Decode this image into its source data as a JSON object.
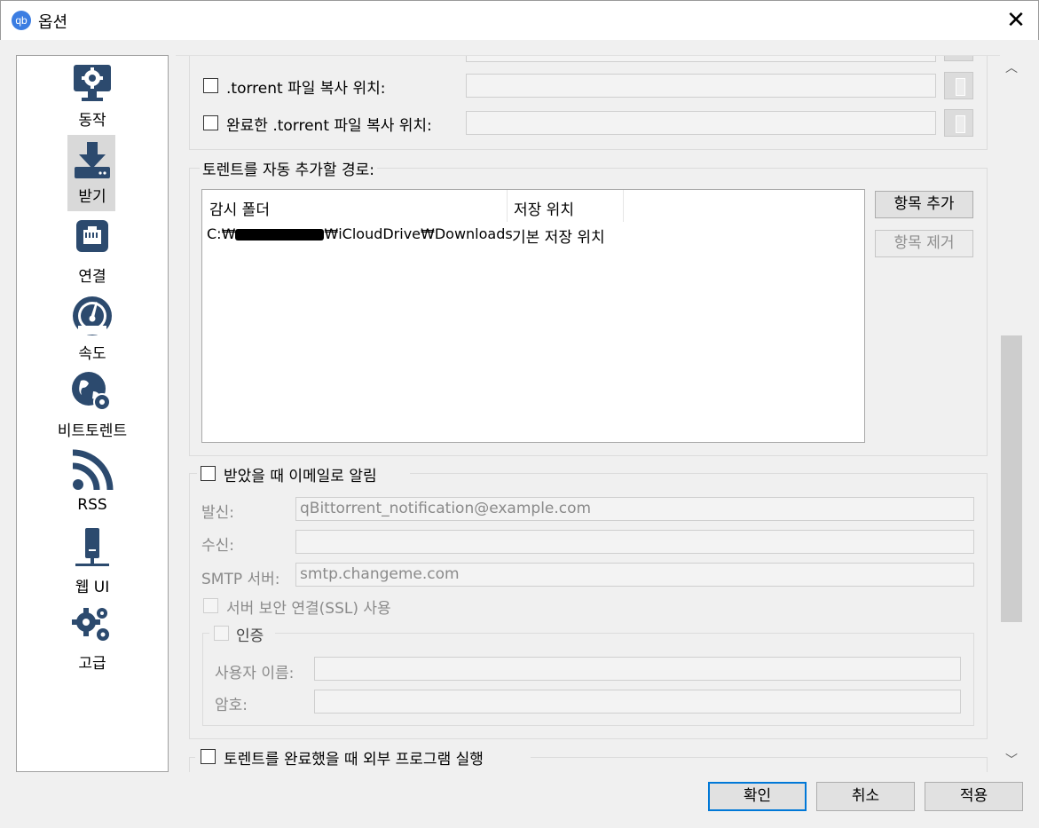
{
  "window": {
    "title": "옵션",
    "app_icon_text": "qb"
  },
  "sidebar": {
    "items": [
      {
        "label": "동작",
        "icon": "monitor-gear-icon"
      },
      {
        "label": "받기",
        "icon": "download-icon"
      },
      {
        "label": "연결",
        "icon": "network-port-icon"
      },
      {
        "label": "속도",
        "icon": "speedometer-icon"
      },
      {
        "label": "비트토렌트",
        "icon": "globe-gear-icon"
      },
      {
        "label": "RSS",
        "icon": "rss-icon"
      },
      {
        "label": "웹 UI",
        "icon": "server-icon"
      },
      {
        "label": "고급",
        "icon": "gears-icon"
      }
    ],
    "selected_label": "받기"
  },
  "copy_torrent": {
    "label": ".torrent 파일 복사 위치:",
    "path": ""
  },
  "copy_finished_torrent": {
    "label": "완료한 .torrent 파일 복사 위치:",
    "path": ""
  },
  "watch_folders": {
    "group_title": "토렌트를 자동 추가할 경로:",
    "columns": [
      "감시 폴더",
      "저장 위치"
    ],
    "rows": [
      {
        "folder_prefix": "C:₩",
        "folder_suffix": "₩iCloudDrive₩Downloads",
        "save_location": "기본 저장 위치"
      }
    ],
    "add_button": "항목 추가",
    "remove_button": "항목 제거"
  },
  "email": {
    "group_title": "받았을 때 이메일로 알림",
    "from_label": "발신:",
    "from_value": "qBittorrent_notification@example.com",
    "to_label": "수신:",
    "to_value": "",
    "smtp_label": "SMTP 서버:",
    "smtp_value": "smtp.changeme.com",
    "ssl_label": "서버 보안 연결(SSL) 사용",
    "auth": {
      "title": "인증",
      "username_label": "사용자 이름:",
      "username_value": "",
      "password_label": "암호:",
      "password_value": ""
    }
  },
  "run_external": {
    "label": "토렌트를 완료했을 때 외부 프로그램 실행"
  },
  "buttons": {
    "ok": "확인",
    "cancel": "취소",
    "apply": "적용"
  },
  "colors": {
    "icon": "#2c4a6e",
    "focus": "#0078d7",
    "app_icon": "#3b7de2"
  }
}
